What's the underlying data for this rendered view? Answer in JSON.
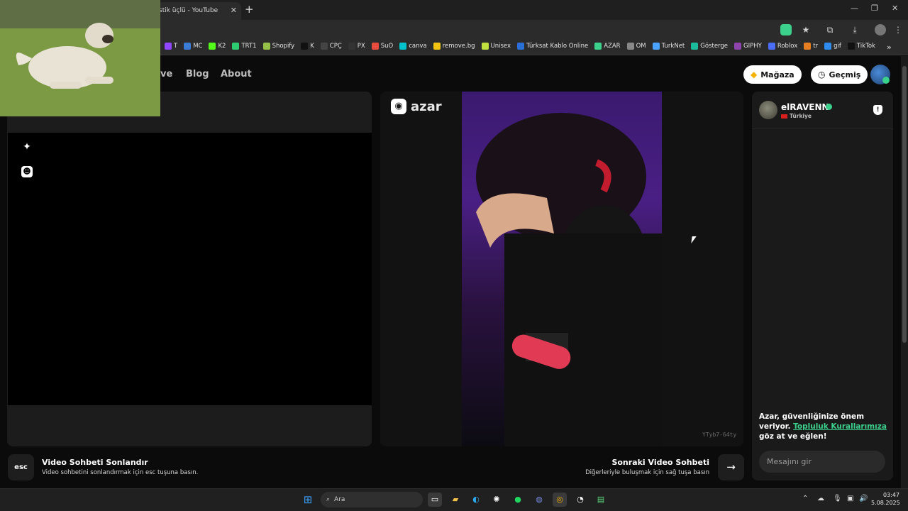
{
  "browser": {
    "tab_title": "stik üçlü - YouTube",
    "tab_close": "✕",
    "new_tab": "+",
    "window_controls": {
      "minimize": "—",
      "restore": "❐",
      "close": "✕"
    },
    "bookmarks": [
      {
        "label": "T",
        "color": "#9146ff"
      },
      {
        "label": "MC",
        "color": "#3a7bd5"
      },
      {
        "label": "K2",
        "color": "#53fc18"
      },
      {
        "label": "TRT1",
        "color": "#2ecc71"
      },
      {
        "label": "Shopify",
        "color": "#95bf47"
      },
      {
        "label": "K",
        "color": "#111111"
      },
      {
        "label": "CPÇ",
        "color": "#444444"
      },
      {
        "label": "PX",
        "color": "#333333"
      },
      {
        "label": "SuO",
        "color": "#e74c3c"
      },
      {
        "label": "canva",
        "color": "#00c4cc"
      },
      {
        "label": "remove.bg",
        "color": "#f1c40f"
      },
      {
        "label": "Unisex",
        "color": "#c0e040"
      },
      {
        "label": "Türksat Kablo Online",
        "color": "#2a6fd6"
      },
      {
        "label": "AZAR",
        "color": "#3bd08b"
      },
      {
        "label": "OM",
        "color": "#888888"
      },
      {
        "label": "TurkNet",
        "color": "#4aa3ff"
      },
      {
        "label": "Gösterge",
        "color": "#1abc9c"
      },
      {
        "label": "GIPHY",
        "color": "#8e44ad"
      },
      {
        "label": "Roblox",
        "color": "#4a6cf7"
      },
      {
        "label": "tr",
        "color": "#e67e22"
      },
      {
        "label": "gif",
        "color": "#2d8cf0"
      },
      {
        "label": "TikTok",
        "color": "#111111"
      }
    ],
    "bookmarks_more": "»"
  },
  "nav": {
    "partial_item": "ve",
    "blog": "Blog",
    "about": "About",
    "store": "Mağaza",
    "history": "Geçmiş"
  },
  "video": {
    "brand": "azar",
    "id": "YTyb7-64ty"
  },
  "partner": {
    "name": "elRAVENN",
    "country": "Türkiye"
  },
  "safety": {
    "text_before": "Azar, güvenliğinize önem veriyor.",
    "link": "Topluluk Kurallarımıza",
    "text_after": "göz at ve eğlen!"
  },
  "chat": {
    "placeholder": "Mesajını gir"
  },
  "actions": {
    "esc_key": "esc",
    "end_title": "Video Sohbeti Sonlandır",
    "end_sub": "Video sohbetini sonlandırmak için esc tuşuna basın.",
    "next_title": "Sonraki Video Sohbeti",
    "next_sub": "Diğerleriyle buluşmak için sağ tuşa basın"
  },
  "taskbar": {
    "search_label": "Ara",
    "time": "03:47",
    "date": "5.08.2025"
  },
  "colors": {
    "accent": "#3bd08b",
    "background": "#0b0b0b"
  }
}
